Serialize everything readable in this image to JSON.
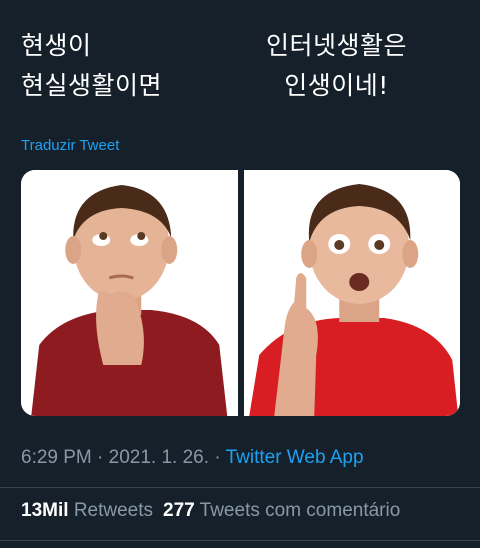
{
  "tweet": {
    "text_left": [
      "현생이",
      "현실생활이면"
    ],
    "text_right": [
      "인터넷생활은",
      "인생이네!"
    ],
    "translate_label": "Traduzir Tweet",
    "media": [
      {
        "icon": "thinking-boy-image"
      },
      {
        "icon": "surprised-boy-idea-image"
      }
    ],
    "time": "6:29 PM",
    "separator": "·",
    "date": "2021. 1. 26.",
    "source": "Twitter Web App"
  },
  "stats": {
    "retweets_count": "13Mil",
    "retweets_label": "Retweets",
    "quotes_count": "277",
    "quotes_label": "Tweets com comentário"
  },
  "colors": {
    "background": "#15202b",
    "accent": "#1da1f2",
    "secondary_text": "#8899a6",
    "divider": "#38444d"
  }
}
